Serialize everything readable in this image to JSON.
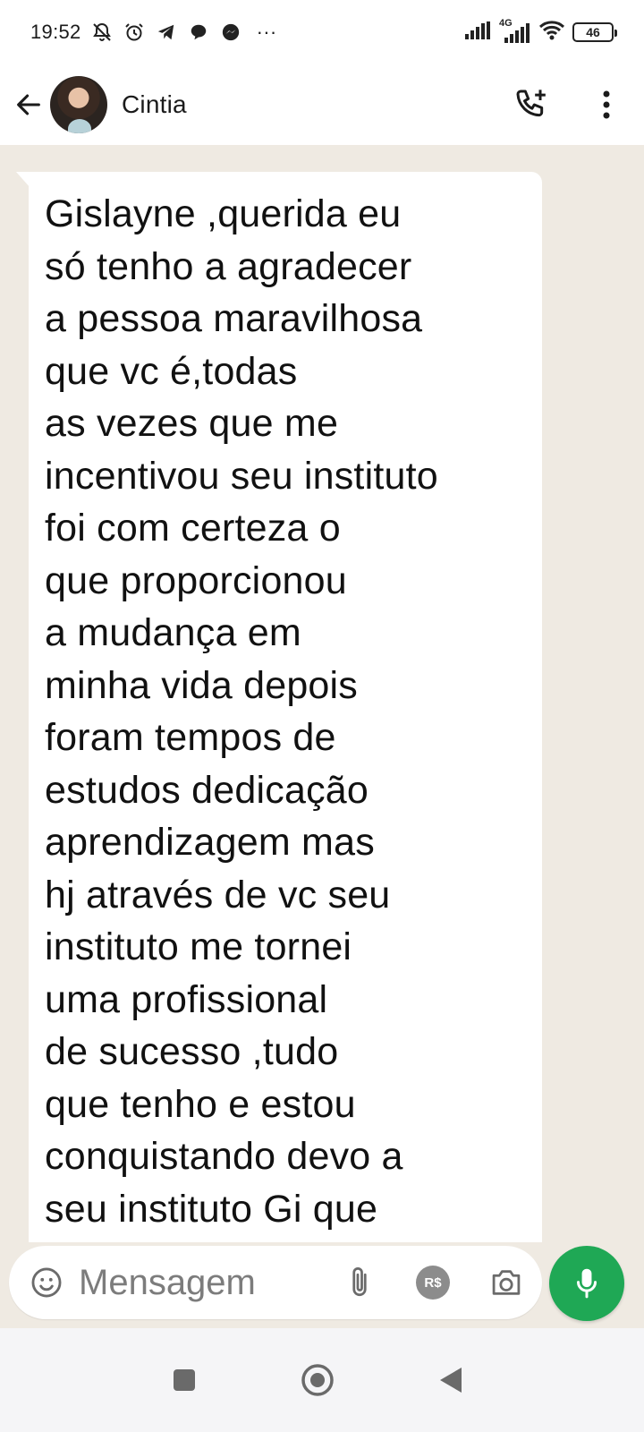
{
  "status_bar": {
    "time": "19:52",
    "battery_level": "46",
    "network": "4G",
    "overflow_dots": "···"
  },
  "header": {
    "contact_name": "Cintia"
  },
  "message": {
    "text": "Gislayne ,querida eu\nsó tenho a agradecer\na pessoa maravilhosa\nque vc é,todas\nas vezes que me\nincentivou seu instituto\nfoi com certeza o\nque proporcionou\na mudança em\nminha vida depois\nforam tempos de\nestudos dedicação\naprendizagem mas\nhj através de vc seu\ninstituto me tornei\numa profissional\nde sucesso ,tudo\nque tenho e estou\nconquistando devo a\nseu instituto Gi que"
  },
  "input": {
    "placeholder": "Mensagem",
    "payment_badge": "R$"
  },
  "colors": {
    "chat_background": "#efeae2",
    "mic_button": "#1fa855",
    "bubble": "#ffffff"
  }
}
